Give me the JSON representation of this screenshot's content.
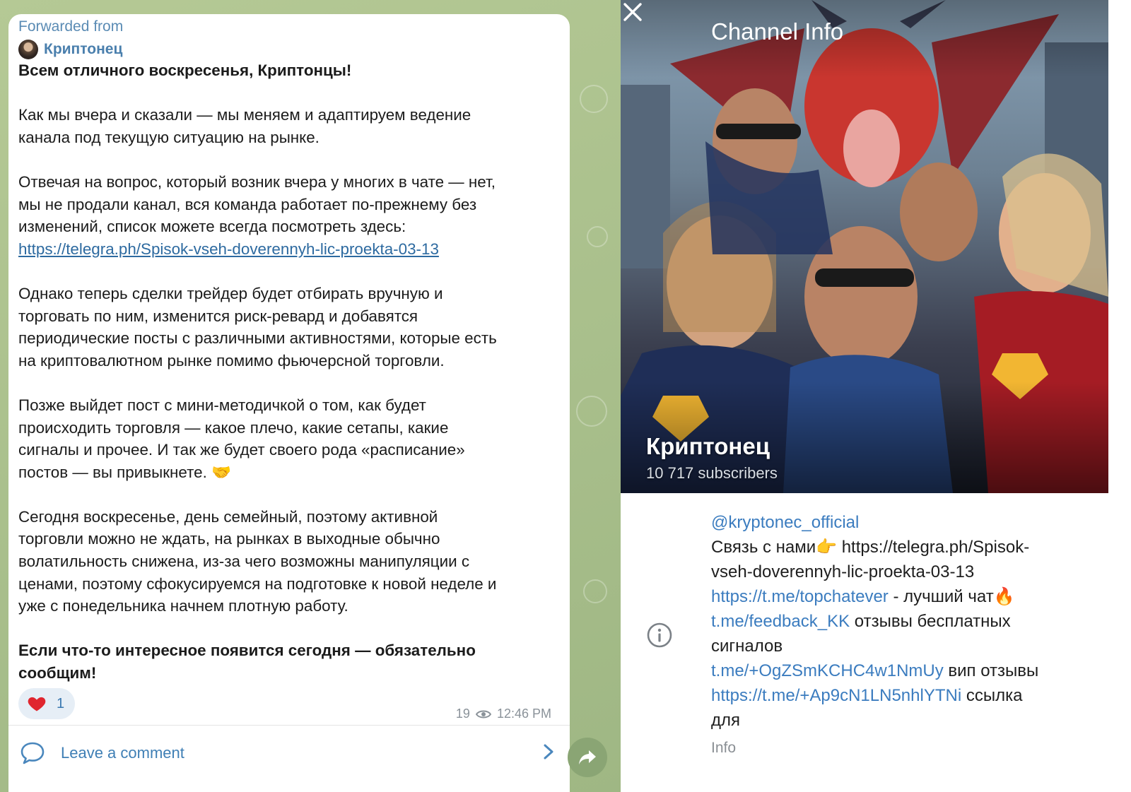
{
  "message": {
    "forwarded_label": "Forwarded from",
    "source_name": "Криптонец",
    "greeting": "Всем отличного воскресенья, Криптонцы!",
    "p1_lines": [
      "Как мы вчера и сказали — мы меняем и адаптируем ведение",
      "канала под текущую ситуацию на рынке."
    ],
    "p2_lines": [
      "Отвечая на вопрос, который возник вчера у многих в чате — нет,",
      "мы не продали канал, вся команда работает по-прежнему без",
      "изменений, список можете всегда посмотреть здесь:"
    ],
    "p2_link": "https://telegra.ph/Spisok-vseh-doverennyh-lic-proekta-03-13",
    "p3_lines": [
      "Однако теперь сделки трейдер будет отбирать вручную и",
      "торговать по ним, изменится риск-ревард и добавятся",
      "периодические посты с различными активностями, которые есть",
      "на криптовалютном рынке помимо фьючерсной торговли."
    ],
    "p4_lines": [
      "Позже выйдет пост с мини-методичкой о том, как будет",
      "происходить торговля — какое плечо, какие сетапы, какие",
      "сигналы и прочее. И так же будет своего рода «расписание»",
      "постов — вы привыкнете. 🤝"
    ],
    "p5_lines": [
      "Сегодня воскресенье, день семейный, поэтому активной",
      "торговли можно не ждать, на рынках в выходные обычно",
      "волатильность снижена, из-за чего возможны манипуляции с",
      "ценами, поэтому сфокусируемся на подготовке к новой неделе и",
      "уже с понедельника начнем плотную работу."
    ],
    "closing_lines": [
      "Если что-то интересное появится сегодня — обязательно",
      "сообщим!"
    ],
    "reaction_count": "1",
    "views": "19",
    "time": "12:46 PM",
    "comment_label": "Leave a comment"
  },
  "channel_info": {
    "title": "Channel Info",
    "name": "Криптонец",
    "subscribers": "10 717 subscribers",
    "username": "@kryptonec_official",
    "desc_line1": "Связь с нами👉 https://telegra.ph/Spisok-",
    "desc_line2": "vseh-doverennyh-lic-proekta-03-13",
    "link1": "https://t.me/topchatever",
    "link1_suffix": " - лучший чат🔥",
    "link2": "t.me/feedback_KK",
    "link2_suffix": " отзывы бесплатных",
    "link2_suffix2": "сигналов",
    "link3": "t.me/+OgZSmKCHC4w1NmUy",
    "link3_suffix": " вип отзывы",
    "link4": "https://t.me/+Ap9cN1LN5nhlYTNi",
    "link4_suffix": " ссылка",
    "tail": "для",
    "caption": "Info"
  },
  "colors": {
    "chat_background": "#a9bf8c",
    "link": "#2d6aa0",
    "accent_blue": "#3f7fb5",
    "heart": "#e0262f"
  },
  "icons": [
    "forward-avatar",
    "heart-icon",
    "eye-icon",
    "comment-icon",
    "chevron-right-icon",
    "share-icon",
    "close-icon",
    "info-icon"
  ]
}
